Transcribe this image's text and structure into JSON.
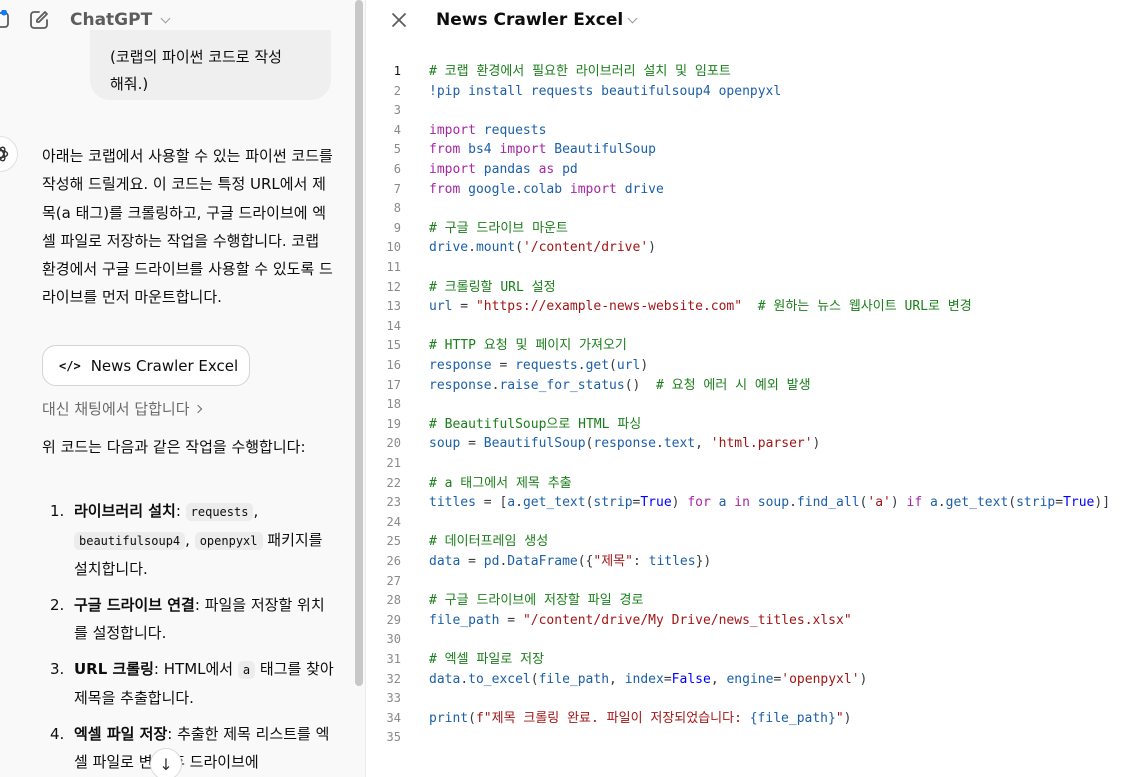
{
  "chat": {
    "app_title": "ChatGPT",
    "user_message": [
      "(코랩의 파이썬 코드로 작성",
      "해줘.)"
    ],
    "assistant_intro": "아래는 코랩에서 사용할 수 있는 파이썬 코드를 작성해 드릴게요. 이 코드는 특정 URL에서 제목(a 태그)를 크롤링하고, 구글 드라이브에 엑셀 파일로 저장하는 작업을 수행합니다. 코랩 환경에서 구글 드라이브를 사용할 수 있도록 드라이브를 먼저 마운트합니다.",
    "canvas_card_icon": "</>",
    "canvas_card_label": "News Crawler Excel",
    "chat_instead": "대신 채팅에서 답합니다",
    "summary": "위 코드는 다음과 같은 작업을 수행합니다:",
    "steps": [
      {
        "num": "1.",
        "title": "라이브러리 설치",
        "sep": ": ",
        "codes": [
          "requests",
          "beautifulsoup4",
          "openpyxl"
        ],
        "text": "패키지를 설치합니다."
      },
      {
        "num": "2.",
        "title": "구글 드라이브 연결",
        "sep": ": ",
        "text": "파일을 저장할 위치를 설정합니다."
      },
      {
        "num": "3.",
        "title": "URL 크롤링",
        "sep": ": ",
        "pre": "HTML에서",
        "code": "a",
        "text": "태그를 찾아 제목을 추출합니다."
      },
      {
        "num": "4.",
        "title": "엑셀 파일 저장",
        "sep": ": ",
        "text": "추출한 제목 리스트를 엑셀 파일로 변환 후 드라이브에"
      }
    ]
  },
  "editor": {
    "doc_title": "News Crawler Excel",
    "active_line": 1,
    "lines": [
      [
        [
          "cm",
          "# 코랩 환경에서 필요한 라이브러리 설치 및 임포트"
        ]
      ],
      [
        [
          "id",
          "!pip install requests beautifulsoup4 openpyxl"
        ]
      ],
      [],
      [
        [
          "kw",
          "import"
        ],
        [
          "pl",
          " "
        ],
        [
          "id",
          "requests"
        ]
      ],
      [
        [
          "kw",
          "from"
        ],
        [
          "pl",
          " "
        ],
        [
          "id",
          "bs4"
        ],
        [
          "pl",
          " "
        ],
        [
          "kw",
          "import"
        ],
        [
          "pl",
          " "
        ],
        [
          "id",
          "BeautifulSoup"
        ]
      ],
      [
        [
          "kw",
          "import"
        ],
        [
          "pl",
          " "
        ],
        [
          "id",
          "pandas"
        ],
        [
          "pl",
          " "
        ],
        [
          "kw",
          "as"
        ],
        [
          "pl",
          " "
        ],
        [
          "id",
          "pd"
        ]
      ],
      [
        [
          "kw",
          "from"
        ],
        [
          "pl",
          " "
        ],
        [
          "id",
          "google"
        ],
        [
          "pl",
          "."
        ],
        [
          "id",
          "colab"
        ],
        [
          "pl",
          " "
        ],
        [
          "kw",
          "import"
        ],
        [
          "pl",
          " "
        ],
        [
          "id",
          "drive"
        ]
      ],
      [],
      [
        [
          "cm",
          "# 구글 드라이브 마운트"
        ]
      ],
      [
        [
          "id",
          "drive"
        ],
        [
          "pl",
          "."
        ],
        [
          "id",
          "mount"
        ],
        [
          "pl",
          "("
        ],
        [
          "st",
          "'/content/drive'"
        ],
        [
          "pl",
          ")"
        ]
      ],
      [],
      [
        [
          "cm",
          "# 크롤링할 URL 설정"
        ]
      ],
      [
        [
          "id",
          "url"
        ],
        [
          "pl",
          " = "
        ],
        [
          "st",
          "\"https://example-news-website.com\""
        ],
        [
          "pl",
          "  "
        ],
        [
          "cm",
          "# 원하는 뉴스 웹사이트 URL로 변경"
        ]
      ],
      [],
      [
        [
          "cm",
          "# HTTP 요청 및 페이지 가져오기"
        ]
      ],
      [
        [
          "id",
          "response"
        ],
        [
          "pl",
          " = "
        ],
        [
          "id",
          "requests"
        ],
        [
          "pl",
          "."
        ],
        [
          "id",
          "get"
        ],
        [
          "pl",
          "("
        ],
        [
          "id",
          "url"
        ],
        [
          "pl",
          ")"
        ]
      ],
      [
        [
          "id",
          "response"
        ],
        [
          "pl",
          "."
        ],
        [
          "id",
          "raise_for_status"
        ],
        [
          "pl",
          "()  "
        ],
        [
          "cm",
          "# 요청 에러 시 예외 발생"
        ]
      ],
      [],
      [
        [
          "cm",
          "# BeautifulSoup으로 HTML 파싱"
        ]
      ],
      [
        [
          "id",
          "soup"
        ],
        [
          "pl",
          " = "
        ],
        [
          "id",
          "BeautifulSoup"
        ],
        [
          "pl",
          "("
        ],
        [
          "id",
          "response"
        ],
        [
          "pl",
          "."
        ],
        [
          "id",
          "text"
        ],
        [
          "pl",
          ", "
        ],
        [
          "st",
          "'html.parser'"
        ],
        [
          "pl",
          ")"
        ]
      ],
      [],
      [
        [
          "cm",
          "# a 태그에서 제목 추출"
        ]
      ],
      [
        [
          "id",
          "titles"
        ],
        [
          "pl",
          " = ["
        ],
        [
          "id",
          "a"
        ],
        [
          "pl",
          "."
        ],
        [
          "id",
          "get_text"
        ],
        [
          "pl",
          "("
        ],
        [
          "id",
          "strip"
        ],
        [
          "pl",
          "="
        ],
        [
          "bt",
          "True"
        ],
        [
          "pl",
          ") "
        ],
        [
          "kw",
          "for"
        ],
        [
          "pl",
          " "
        ],
        [
          "id",
          "a"
        ],
        [
          "pl",
          " "
        ],
        [
          "kw",
          "in"
        ],
        [
          "pl",
          " "
        ],
        [
          "id",
          "soup"
        ],
        [
          "pl",
          "."
        ],
        [
          "id",
          "find_all"
        ],
        [
          "pl",
          "("
        ],
        [
          "st",
          "'a'"
        ],
        [
          "pl",
          ") "
        ],
        [
          "kw",
          "if"
        ],
        [
          "pl",
          " "
        ],
        [
          "id",
          "a"
        ],
        [
          "pl",
          "."
        ],
        [
          "id",
          "get_text"
        ],
        [
          "pl",
          "("
        ],
        [
          "id",
          "strip"
        ],
        [
          "pl",
          "="
        ],
        [
          "bt",
          "True"
        ],
        [
          "pl",
          ")]"
        ]
      ],
      [],
      [
        [
          "cm",
          "# 데이터프레임 생성"
        ]
      ],
      [
        [
          "id",
          "data"
        ],
        [
          "pl",
          " = "
        ],
        [
          "id",
          "pd"
        ],
        [
          "pl",
          "."
        ],
        [
          "id",
          "DataFrame"
        ],
        [
          "pl",
          "({"
        ],
        [
          "st",
          "\"제목\""
        ],
        [
          "pl",
          ": "
        ],
        [
          "id",
          "titles"
        ],
        [
          "pl",
          "})"
        ]
      ],
      [],
      [
        [
          "cm",
          "# 구글 드라이브에 저장할 파일 경로"
        ]
      ],
      [
        [
          "id",
          "file_path"
        ],
        [
          "pl",
          " = "
        ],
        [
          "st",
          "\"/content/drive/My Drive/news_titles.xlsx\""
        ]
      ],
      [],
      [
        [
          "cm",
          "# 엑셀 파일로 저장"
        ]
      ],
      [
        [
          "id",
          "data"
        ],
        [
          "pl",
          "."
        ],
        [
          "id",
          "to_excel"
        ],
        [
          "pl",
          "("
        ],
        [
          "id",
          "file_path"
        ],
        [
          "pl",
          ", "
        ],
        [
          "id",
          "index"
        ],
        [
          "pl",
          "="
        ],
        [
          "bt",
          "False"
        ],
        [
          "pl",
          ", "
        ],
        [
          "id",
          "engine"
        ],
        [
          "pl",
          "="
        ],
        [
          "st",
          "'openpyxl'"
        ],
        [
          "pl",
          ")"
        ]
      ],
      [],
      [
        [
          "id",
          "print"
        ],
        [
          "pl",
          "("
        ],
        [
          "st",
          "f\"제목 크롤링 완료. 파일이 저장되었습니다: "
        ],
        [
          "id",
          "{file_path}"
        ],
        [
          "st",
          "\""
        ],
        [
          "pl",
          ")"
        ]
      ],
      []
    ]
  }
}
